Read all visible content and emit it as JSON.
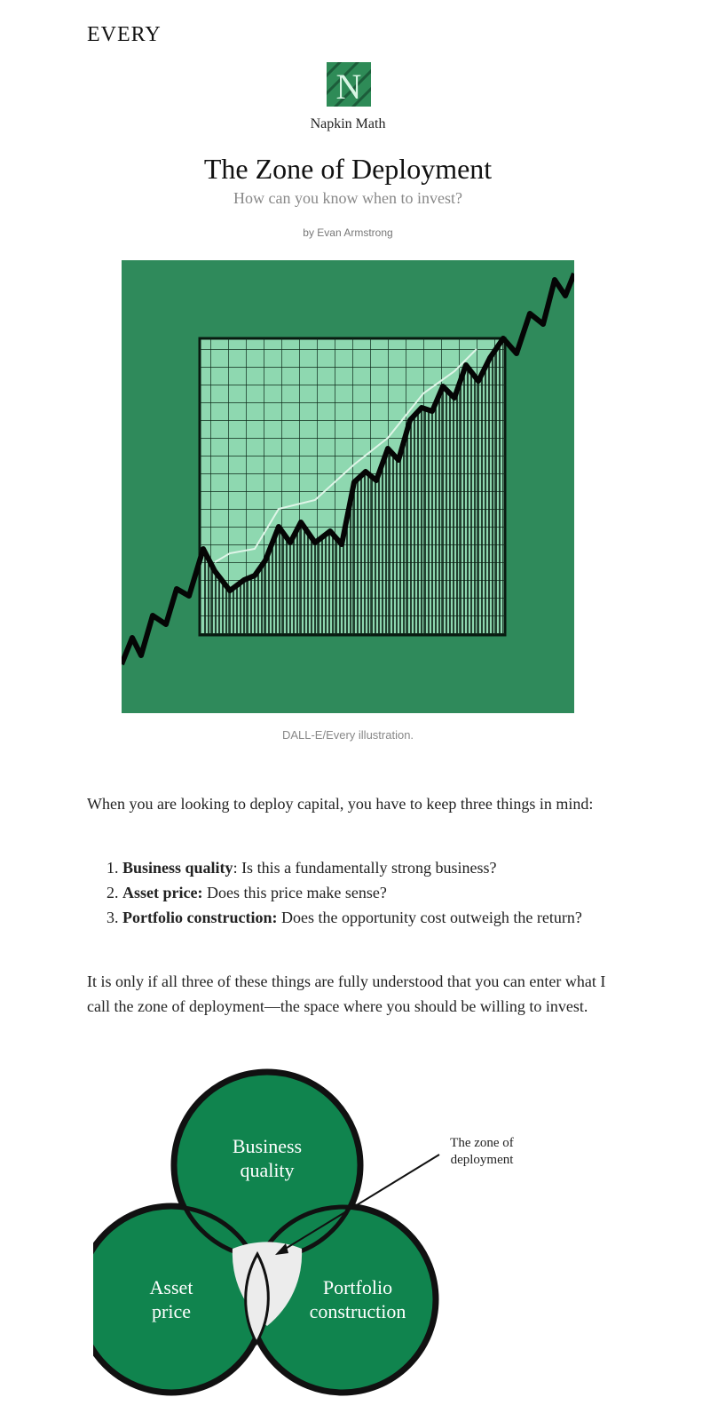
{
  "header": {
    "brand": "EVERY"
  },
  "publication": {
    "name": "Napkin Math",
    "logo_letter": "N",
    "logo_color": "#2e8b57"
  },
  "article": {
    "title": "The Zone of Deployment",
    "subtitle": "How can you know when to invest?",
    "byline": "by Evan Armstrong"
  },
  "hero": {
    "caption": "DALL-E/Every illustration.",
    "background": "#2f8a5b"
  },
  "content": {
    "intro": "When you are looking to deploy capital, you have to keep three things in mind:",
    "list": [
      {
        "term": "Business quality",
        "text": ": Is this a fundamentally strong business?"
      },
      {
        "term": "Asset price:",
        "text": " Does this price make sense?"
      },
      {
        "term": "Portfolio construction:",
        "text": " Does the opportunity cost outweigh the return?"
      }
    ],
    "conclusion": "It is only if all three of these things are fully understood that you can enter what I call the zone of deployment—the space where you should be willing to invest."
  },
  "venn": {
    "circle_color": "#10844e",
    "labels": {
      "top_1": "Business",
      "top_2": "quality",
      "left_1": "Asset",
      "left_2": "price",
      "right_1": "Portfolio",
      "right_2": "construction"
    },
    "annotation_1": "The zone of",
    "annotation_2": "deployment"
  }
}
